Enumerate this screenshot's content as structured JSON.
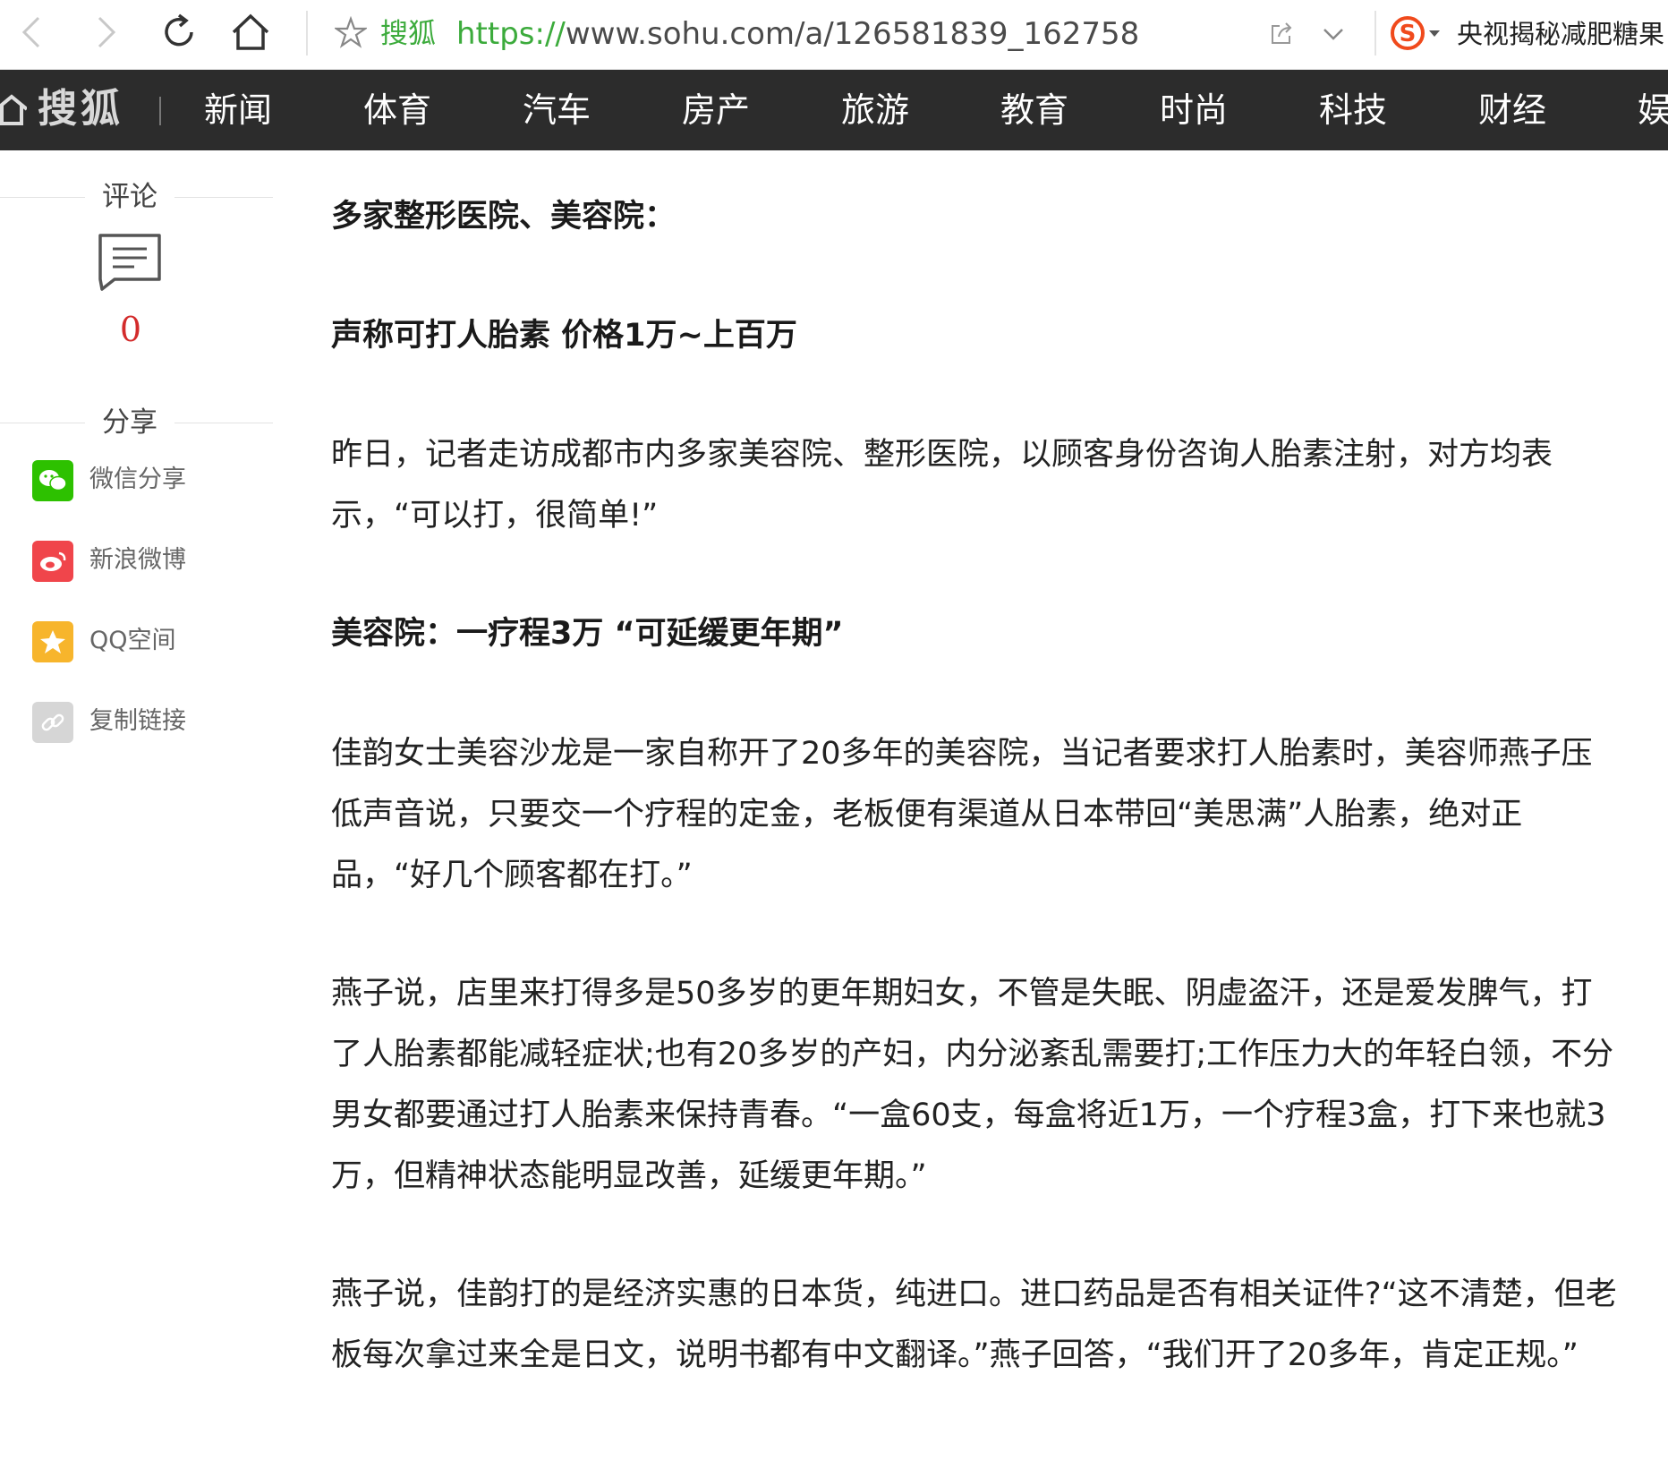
{
  "browser": {
    "site_label": "搜狐",
    "url_protocol": "https://",
    "url_rest": "www.sohu.com/a/126581839_162758",
    "search_text": "央视揭秘减肥糖果"
  },
  "channel_nav": {
    "logo": "搜狐",
    "items": [
      "新闻",
      "体育",
      "汽车",
      "房产",
      "旅游",
      "教育",
      "时尚",
      "科技",
      "财经",
      "娱"
    ]
  },
  "sidebar": {
    "comment_label": "评论",
    "comment_count": "0",
    "share_label": "分享",
    "share_items": [
      {
        "label": "微信分享",
        "icon": "wechat-icon",
        "color": "#2dc100"
      },
      {
        "label": "新浪微博",
        "icon": "weibo-icon",
        "color": "#f0454b"
      },
      {
        "label": "QQ空间",
        "icon": "qzone-star-icon",
        "color": "#f7b52c"
      },
      {
        "label": "复制链接",
        "icon": "link-icon",
        "color": "#d6d6d6"
      }
    ]
  },
  "article": {
    "paragraphs": [
      {
        "text": "多家整形医院、美容院：",
        "heading": true
      },
      {
        "text": "声称可打人胎素 价格1万~上百万",
        "heading": true
      },
      {
        "text": "昨日，记者走访成都市内多家美容院、整形医院，以顾客身份咨询人胎素注射，对方均表示，“可以打，很简单!”",
        "heading": false
      },
      {
        "text": "美容院：一疗程3万 “可延缓更年期”",
        "heading": true
      },
      {
        "text": "佳韵女士美容沙龙是一家自称开了20多年的美容院，当记者要求打人胎素时，美容师燕子压低声音说，只要交一个疗程的定金，老板便有渠道从日本带回“美思满”人胎素，绝对正品，“好几个顾客都在打。”",
        "heading": false
      },
      {
        "text": "燕子说，店里来打得多是50多岁的更年期妇女，不管是失眠、阴虚盗汗，还是爱发脾气，打了人胎素都能减轻症状;也有20多岁的产妇，内分泌紊乱需要打;工作压力大的年轻白领，不分男女都要通过打人胎素来保持青春。“一盒60支，每盒将近1万，一个疗程3盒，打下来也就3万，但精神状态能明显改善，延缓更年期。”",
        "heading": false
      },
      {
        "text": "燕子说，佳韵打的是经济实惠的日本货，纯进口。进口药品是否有相关证件?“这不清楚，但老板每次拿过来全是日文，说明书都有中文翻译。”燕子回答，“我们开了20多年，肯定正规。”",
        "heading": false
      }
    ]
  }
}
